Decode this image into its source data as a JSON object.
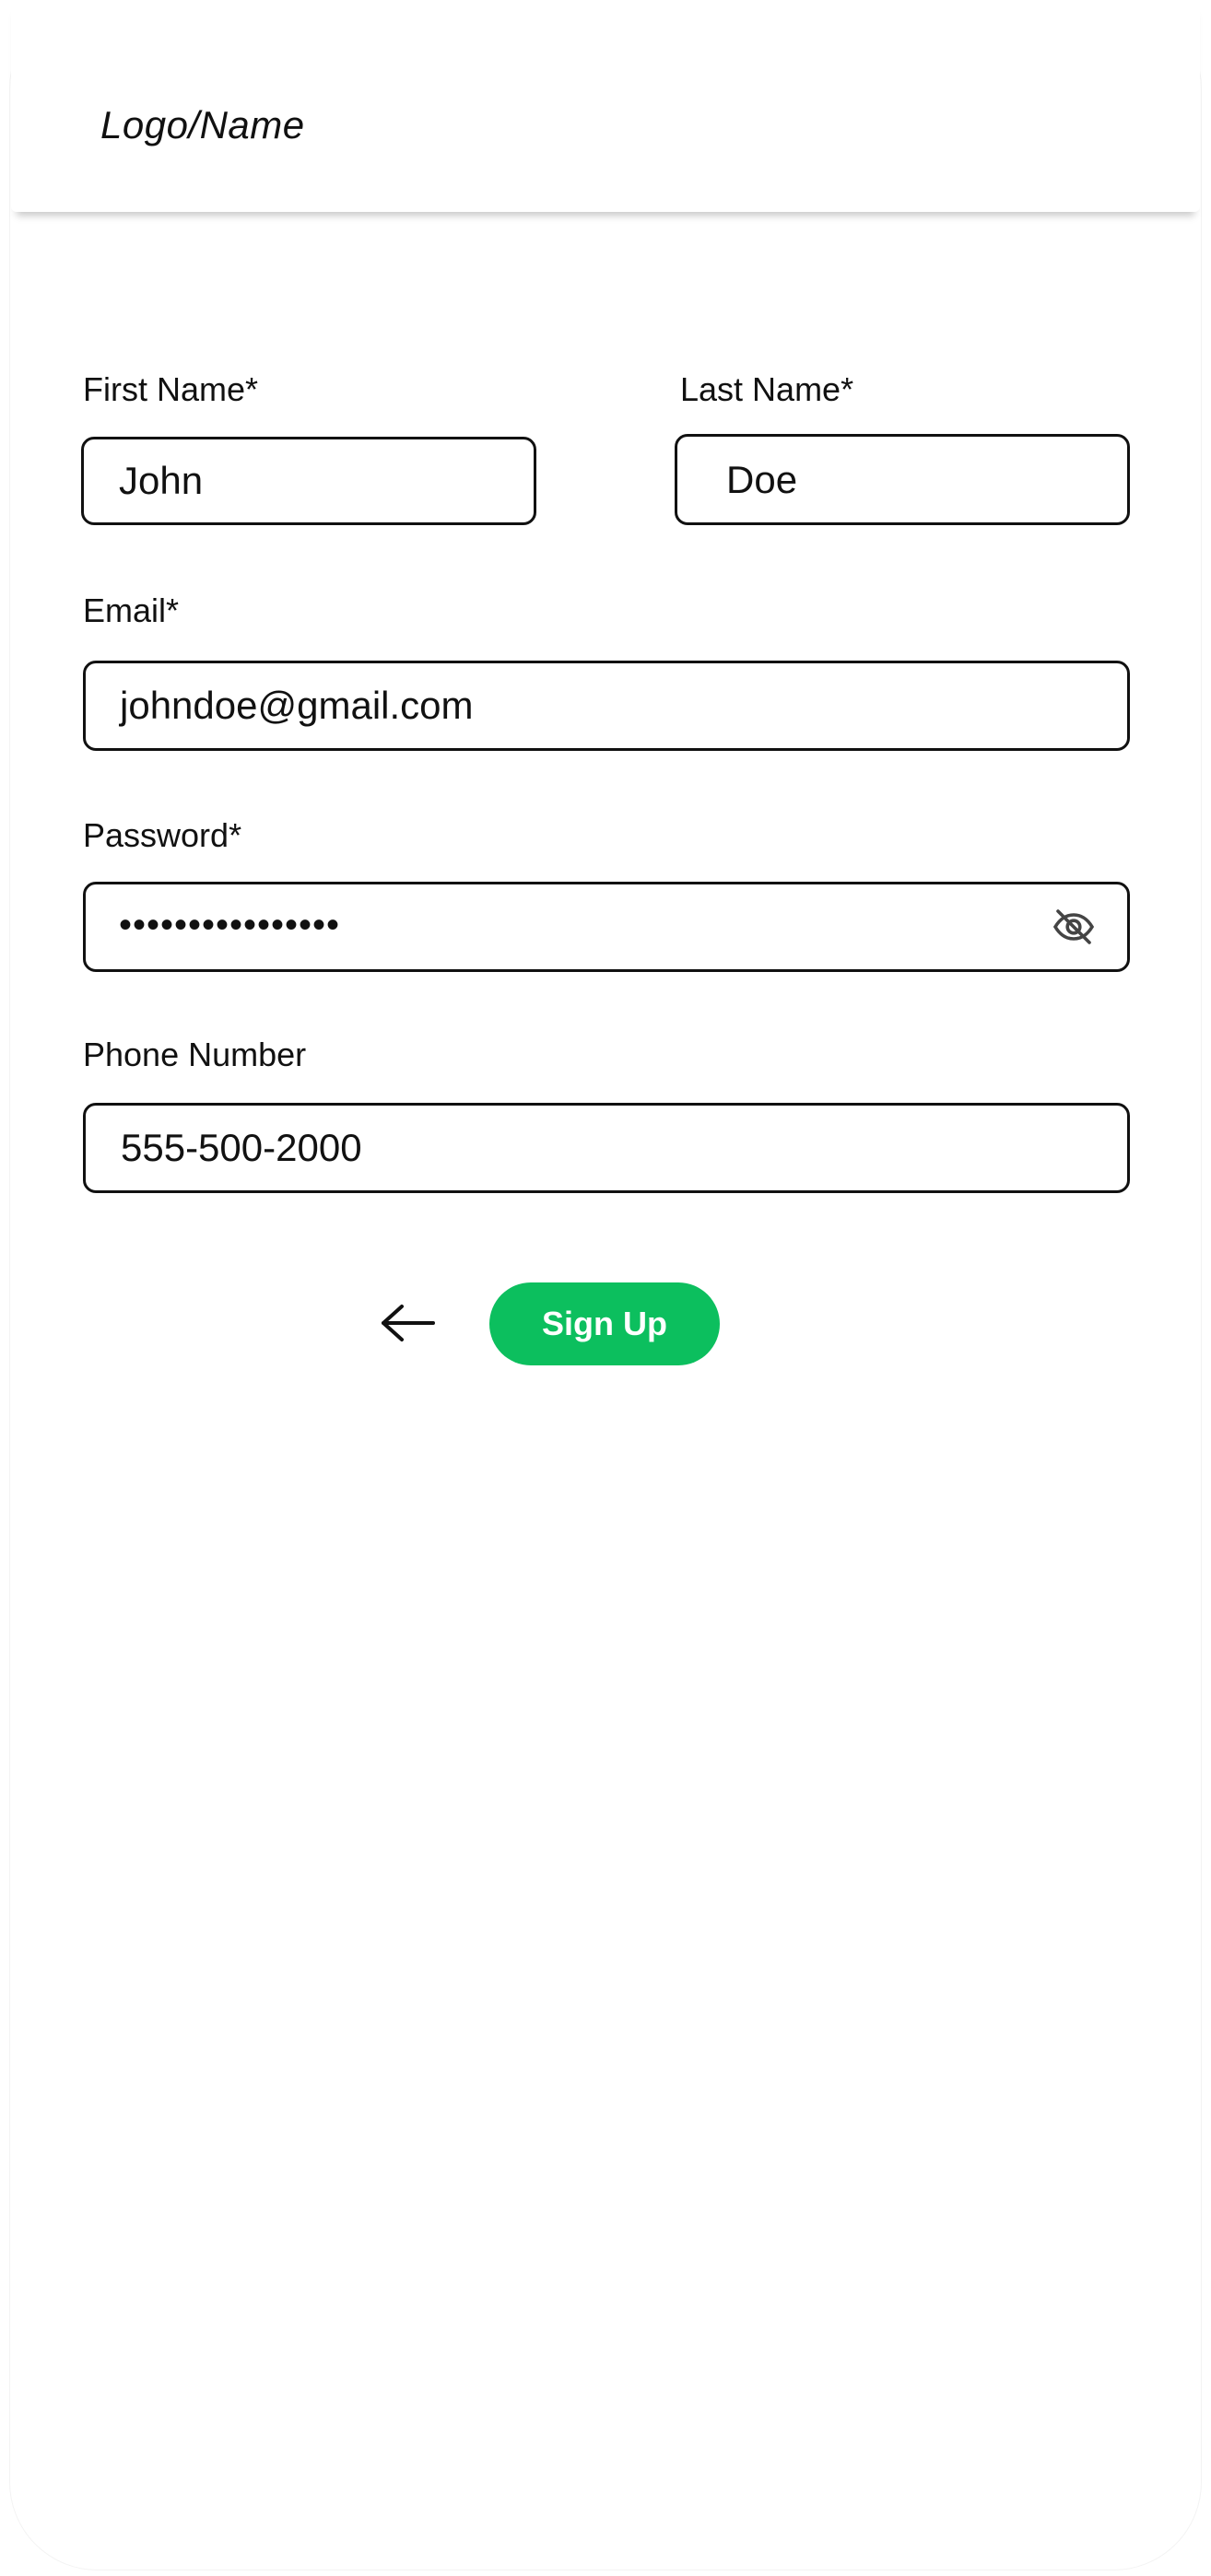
{
  "header": {
    "logo_text": "Logo/Name"
  },
  "form": {
    "first_name": {
      "label": "First Name*",
      "value": "John"
    },
    "last_name": {
      "label": "Last Name*",
      "value": "Doe"
    },
    "email": {
      "label": "Email*",
      "value": "johndoe@gmail.com"
    },
    "password": {
      "label": "Password*",
      "masked_value": "••••••••••••••••"
    },
    "phone": {
      "label": "Phone Number",
      "value": "555-500-2000"
    }
  },
  "icons": {
    "password_toggle": "eye-off-icon",
    "back": "arrow-left-icon"
  },
  "actions": {
    "signup_label": "Sign Up"
  },
  "colors": {
    "accent": "#0CBF5E",
    "text": "#111111",
    "background": "#FFFFFF"
  }
}
